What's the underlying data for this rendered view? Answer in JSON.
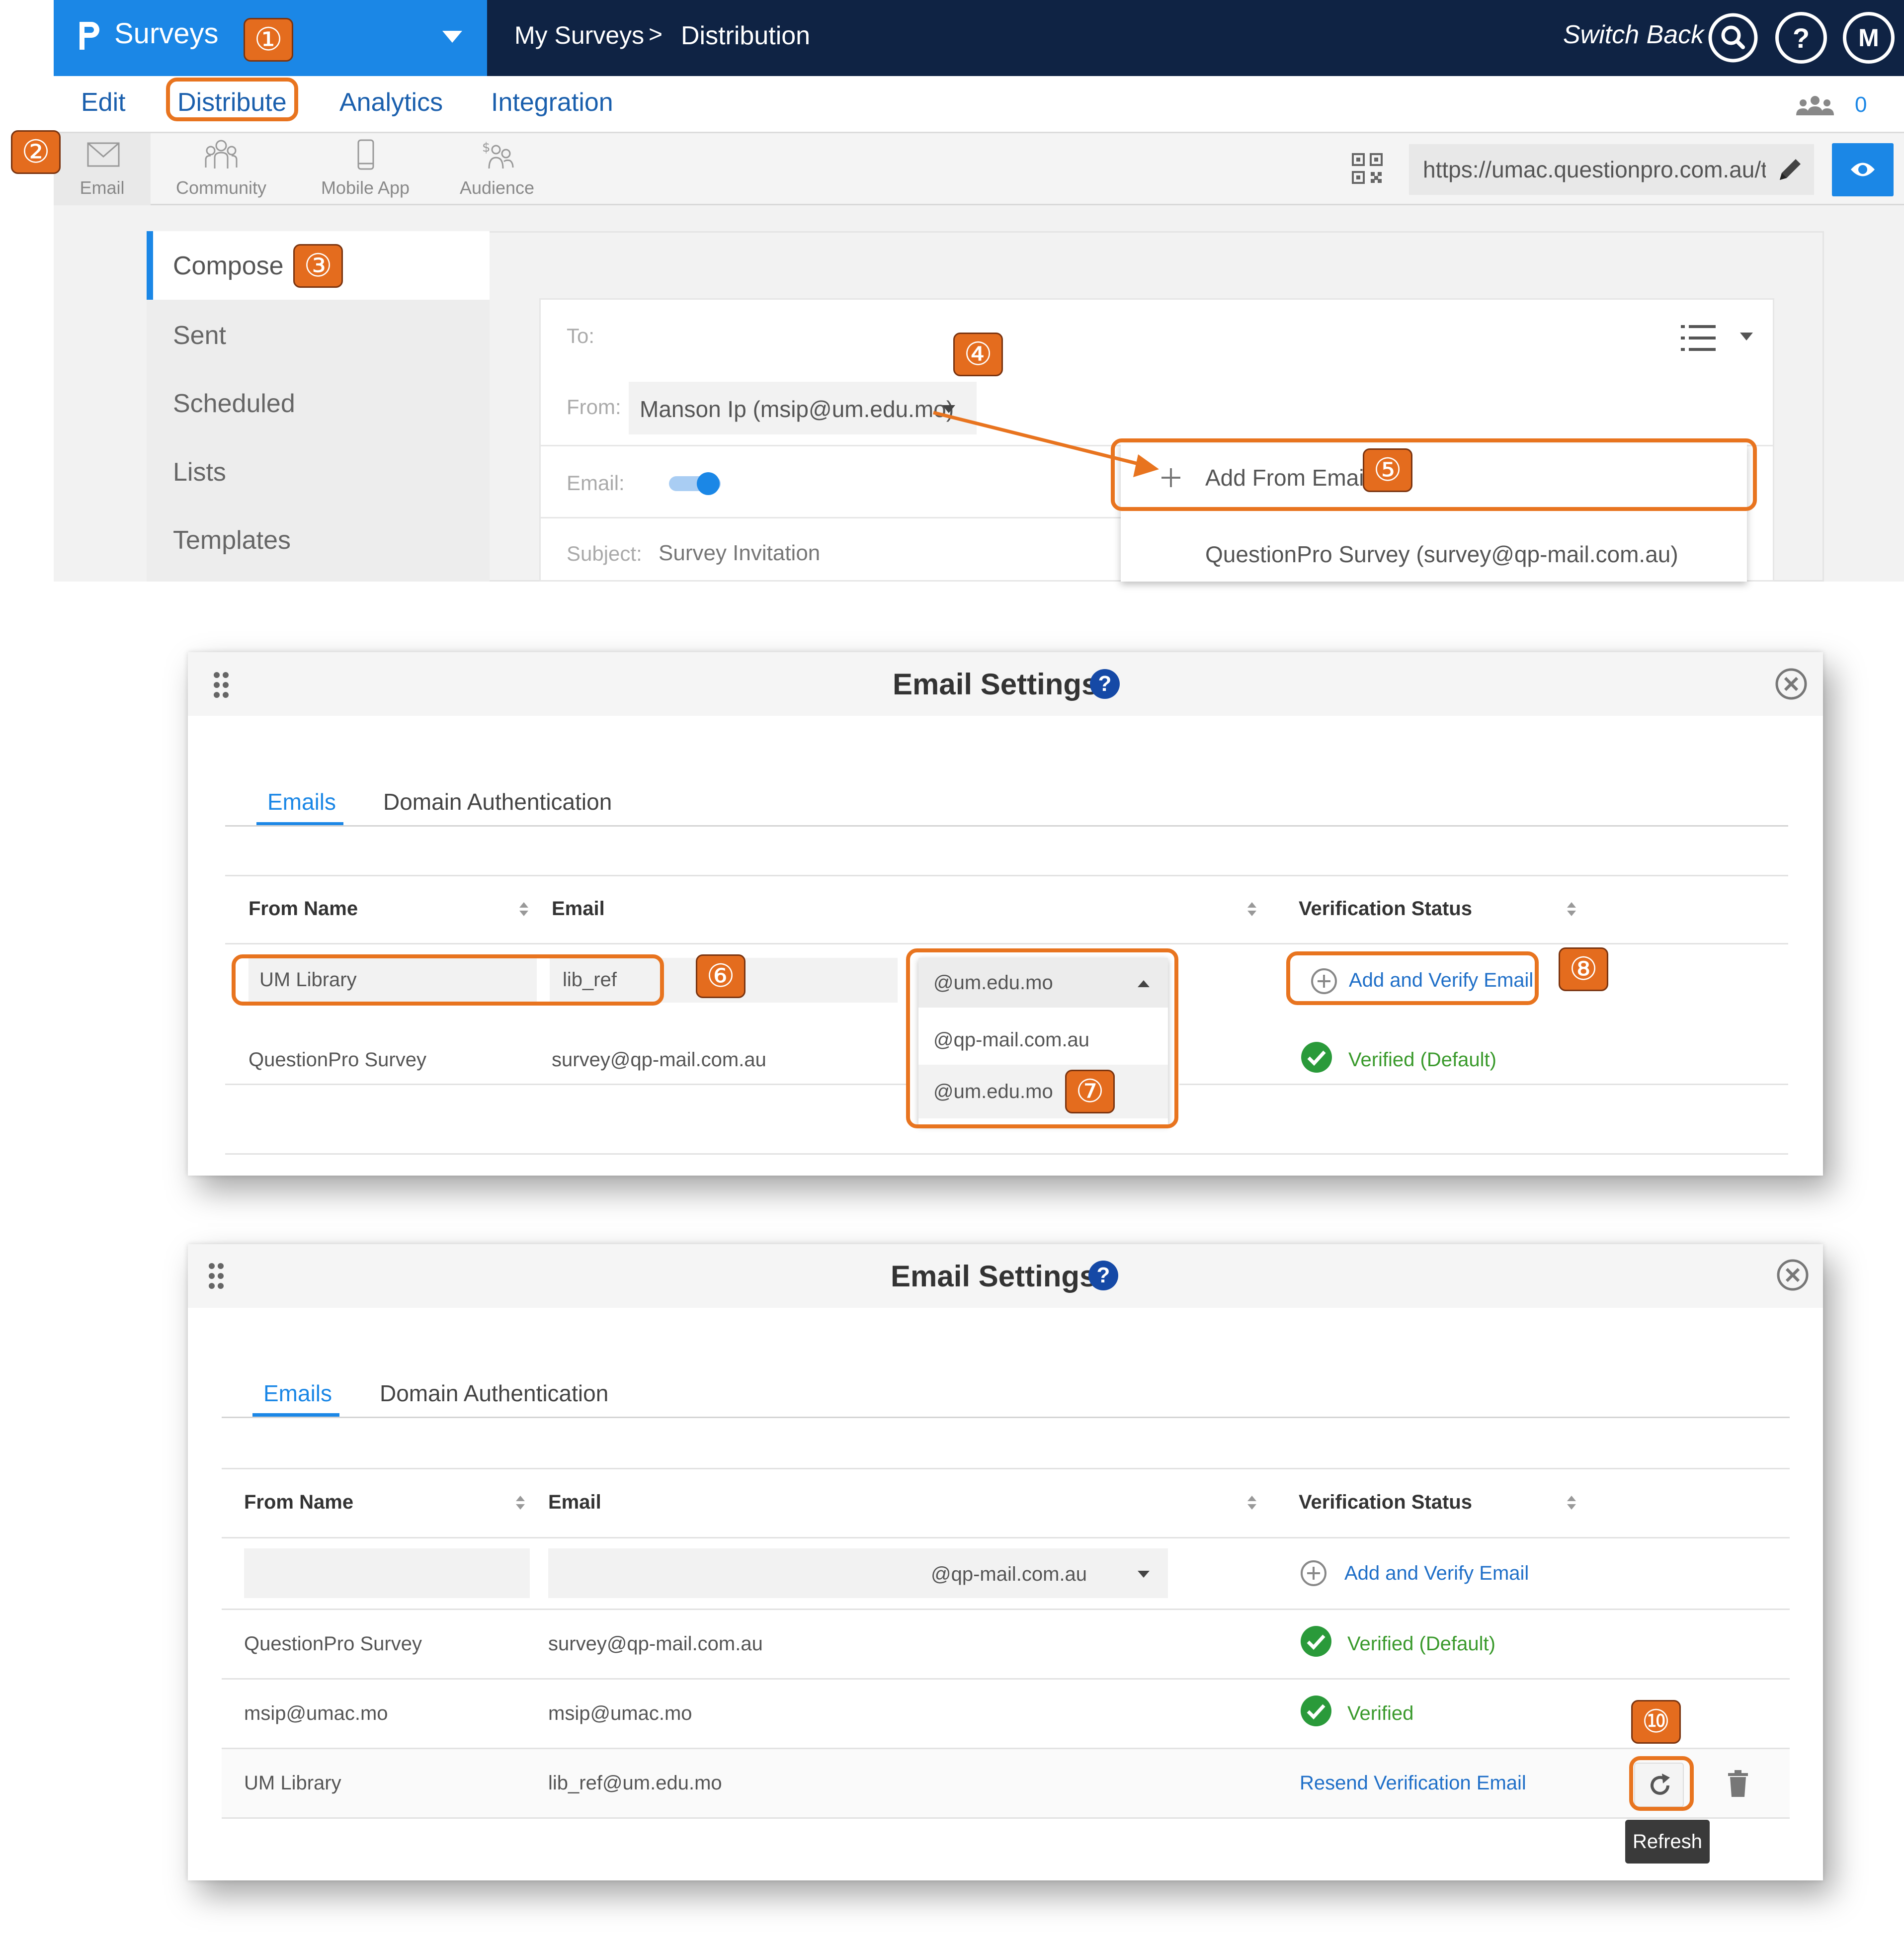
{
  "app": {
    "brand": "Surveys",
    "breadcrumb_root": "My Surveys",
    "breadcrumb_sep": ">",
    "breadcrumb_current": "Distribution",
    "switch_back": "Switch Back",
    "help_glyph": "?",
    "user_initial": "M",
    "team_count": "0"
  },
  "menu": {
    "edit": "Edit",
    "distribute": "Distribute",
    "analytics": "Analytics",
    "integration": "Integration"
  },
  "toolbar": {
    "email": "Email",
    "community": "Community",
    "mobile_app": "Mobile App",
    "audience": "Audience",
    "survey_url": "https://umac.questionpro.com.au/t/"
  },
  "leftnav": {
    "compose": "Compose",
    "sent": "Sent",
    "scheduled": "Scheduled",
    "lists": "Lists",
    "templates": "Templates"
  },
  "compose": {
    "to_label": "To:",
    "from_label": "From:",
    "from_value": "Manson Ip (msip@um.edu.mo)",
    "email_label": "Email:",
    "email_toggle_on": true,
    "subject_label": "Subject:",
    "subject_value": "Survey Invitation",
    "add_from_email": "Add From Email",
    "from_option_1": "QuestionPro Survey (survey@qp-mail.com.au)"
  },
  "markers": [
    "①",
    "②",
    "③",
    "④",
    "⑤",
    "⑥",
    "⑦",
    "⑧",
    "⑩"
  ],
  "dialog1": {
    "title": "Email Settings",
    "help_glyph": "?",
    "tab_emails": "Emails",
    "tab_domain": "Domain Authentication",
    "col_from_name": "From Name",
    "col_email": "Email",
    "col_status": "Verification Status",
    "new_from_name": "UM Library",
    "new_email_local": "lib_ref",
    "domain_selected": "@um.edu.mo",
    "domain_options": [
      "@qp-mail.com.au",
      "@um.edu.mo"
    ],
    "add_verify": "Add and Verify Email",
    "row1_name": "QuestionPro Survey",
    "row1_email": "survey@qp-mail.com.au",
    "row1_status": "Verified (Default)"
  },
  "dialog2": {
    "title": "Email Settings",
    "help_glyph": "?",
    "tab_emails": "Emails",
    "tab_domain": "Domain Authentication",
    "col_from_name": "From Name",
    "col_email": "Email",
    "col_status": "Verification Status",
    "domain_selected": "@qp-mail.com.au",
    "add_verify": "Add and Verify Email",
    "rows": [
      {
        "name": "QuestionPro Survey",
        "email": "survey@qp-mail.com.au",
        "status": "Verified (Default)"
      },
      {
        "name": "msip@umac.mo",
        "email": "msip@umac.mo",
        "status": "Verified"
      },
      {
        "name": "UM Library",
        "email": "lib_ref@um.edu.mo",
        "status": "Resend Verification Email"
      }
    ],
    "tooltip_refresh": "Refresh"
  },
  "colors": {
    "brand_blue": "#1b87e6",
    "navy": "#0f2344",
    "marker_orange": "#e46c1e",
    "verified_green": "#3a9a2c",
    "link_blue": "#1f6fc8"
  }
}
